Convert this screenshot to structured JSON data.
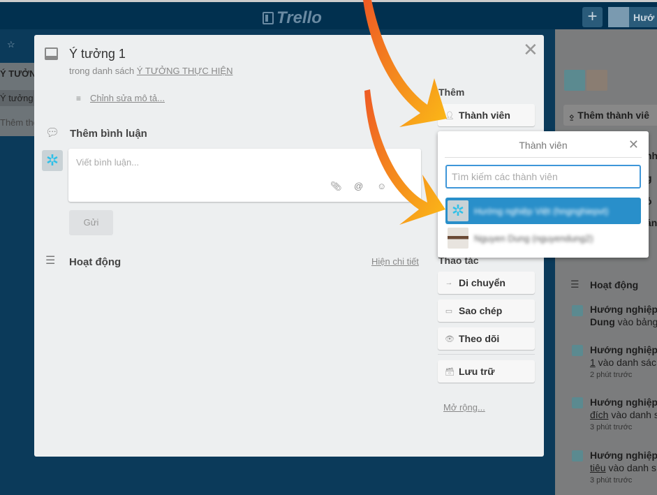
{
  "header": {
    "logo": "Trello",
    "add_label": "+",
    "user_label": "Hướ"
  },
  "board": {
    "list_title": "Ý TƯỞN",
    "card": "Ý tưởng",
    "add_card": "Thêm the"
  },
  "card": {
    "title": "Ý tưởng 1",
    "list_prefix": "trong danh sách ",
    "list_name": "Ý TƯỞNG THỰC HIỆN",
    "edit_description": "Chỉnh sửa mô tả...",
    "comment_heading": "Thêm bình luận",
    "comment_placeholder": "Viết bình luận...",
    "send_label": "Gửi",
    "activity_heading": "Hoạt động",
    "show_details": "Hiện chi tiết"
  },
  "sidebar": {
    "add_heading": "Thêm",
    "members_button": "Thành viên",
    "actions_heading": "Thao tác",
    "actions": [
      {
        "label": "Di chuyển",
        "icon": "arrow-right-icon"
      },
      {
        "label": "Sao chép",
        "icon": "card-icon"
      },
      {
        "label": "Theo dõi",
        "icon": "eye-icon"
      }
    ],
    "archive": "Lưu trữ",
    "expand": "Mở rộng..."
  },
  "popup": {
    "title": "Thành viên",
    "search_placeholder": "Tìm kiếm các thành viên",
    "members": [
      {
        "name": "Hướng nghiệp Việt (hngnghiepvt)",
        "selected": true
      },
      {
        "name": "Nguyen Dung (nguyendung2)",
        "selected": false
      }
    ],
    "highlight_color": "#298fca"
  },
  "right_panel": {
    "add_member": "Thêm thành viê",
    "peek": [
      "nh",
      "g",
      "ỏ",
      "án"
    ],
    "activity_heading": "Hoạt động",
    "items": [
      {
        "actor": "Hướng nghiệp",
        "rest_link": "Dung",
        "rest": " vào bảng",
        "time": ""
      },
      {
        "actor": "Hướng nghiệp",
        "rest_link": "1",
        "rest": " vào danh sác",
        "time": "2 phút trước"
      },
      {
        "actor": "Hướng nghiệp",
        "rest_link": "đích",
        "rest": " vào danh s",
        "time": "3 phút trước"
      },
      {
        "actor": "Hướng nghiệp",
        "rest_link": "tiêu",
        "rest": " vào danh s",
        "time": "3 phút trước"
      }
    ]
  },
  "colors": {
    "accent": "#298fca",
    "arrow_start": "#ee5a24",
    "arrow_end": "#fbb917"
  }
}
